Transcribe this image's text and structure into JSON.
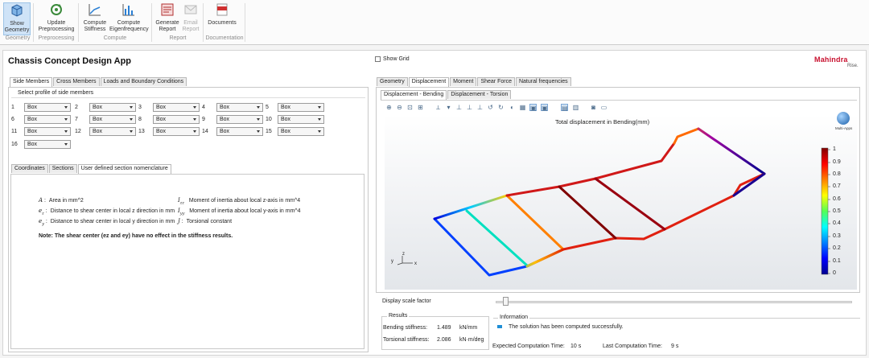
{
  "ribbon": {
    "buttons": [
      {
        "id": "show-geometry",
        "line1": "Show",
        "line2": "Geometry",
        "active": true
      },
      {
        "id": "update-preprocessing",
        "line1": "Update",
        "line2": "Preprocessing"
      },
      {
        "id": "compute-stiffness",
        "line1": "Compute",
        "line2": "Stiffness"
      },
      {
        "id": "compute-eigenfrequency",
        "line1": "Compute",
        "line2": "Eigenfrequency"
      },
      {
        "id": "generate-report",
        "line1": "Generate",
        "line2": "Report"
      },
      {
        "id": "email-report",
        "line1": "Email",
        "line2": "Report",
        "disabled": true
      },
      {
        "id": "documents",
        "line1": "Documents",
        "line2": ""
      }
    ],
    "groups": [
      "Geometry",
      "Preprocessing",
      "Compute",
      "Report",
      "Documentation"
    ]
  },
  "app": {
    "title": "Chassis Concept Design App",
    "show_grid": "Show Grid",
    "logo_main": "Mahindra",
    "logo_sub": "Rise."
  },
  "left": {
    "tabs": [
      "Side Members",
      "Cross Members",
      "Loads and Boundary Conditions"
    ],
    "section_title": "Select profile of side members",
    "members": [
      {
        "n": "1",
        "v": "Box"
      },
      {
        "n": "2",
        "v": "Box"
      },
      {
        "n": "3",
        "v": "Box"
      },
      {
        "n": "4",
        "v": "Box"
      },
      {
        "n": "5",
        "v": "Box"
      },
      {
        "n": "6",
        "v": "Box"
      },
      {
        "n": "7",
        "v": "Box"
      },
      {
        "n": "8",
        "v": "Box"
      },
      {
        "n": "9",
        "v": "Box"
      },
      {
        "n": "10",
        "v": "Box"
      },
      {
        "n": "11",
        "v": "Box"
      },
      {
        "n": "12",
        "v": "Box"
      },
      {
        "n": "13",
        "v": "Box"
      },
      {
        "n": "14",
        "v": "Box"
      },
      {
        "n": "15",
        "v": "Box"
      },
      {
        "n": "16",
        "v": "Box"
      }
    ],
    "subtabs": [
      "Coordinates",
      "Sections",
      "User defined section nomenclature"
    ],
    "nomenclature": [
      {
        "sym": "A",
        "sub": "",
        "desc": "Area in mm^2"
      },
      {
        "sym": "e",
        "sub": "z",
        "desc": "Distance to shear center in local z direction in mm"
      },
      {
        "sym": "e",
        "sub": "y",
        "desc": "Distance to shear center in local y direction in mm"
      },
      {
        "sym": "I",
        "sub": "zz",
        "desc": "Moment of inertia about local z-axis in mm^4"
      },
      {
        "sym": "I",
        "sub": "yy",
        "desc": "Moment of inertia about local y-axis in mm^4"
      },
      {
        "sym": "J",
        "sub": "",
        "desc": "Torsional constant"
      }
    ],
    "note": "Note: The shear center (ez and ey) have no effect in the stiffness results."
  },
  "right": {
    "tabs": [
      "Geometry",
      "Displacement",
      "Moment",
      "Shear Force",
      "Natural frequencies"
    ],
    "subtabs": [
      "Displacement - Bending",
      "Displacement - Torsion"
    ],
    "plot_title": "Total displacement in Bending(mm)",
    "legend": [
      "1",
      "0.9",
      "0.8",
      "0.7",
      "0.6",
      "0.5",
      "0.4",
      "0.3",
      "0.2",
      "0.1",
      "0"
    ],
    "axis": {
      "y": "y",
      "z": "z",
      "x": "x"
    },
    "badge": "Multi-Apps",
    "scale_label": "Display scale factor",
    "scale_fraction": 0.02,
    "results_title": "Results",
    "bending_label": "Bending stiffness:",
    "bending_value": "1.489",
    "bending_unit": "kN/mm",
    "torsional_label": "Torsional stiffness:",
    "torsional_value": "2.086",
    "torsional_unit": "kN·m/deg",
    "info_title": "Information",
    "info_msg": "The solution has been computed successfully.",
    "expected_label": "Expected Computation Time:",
    "expected_value": "10 s",
    "last_label": "Last Computation Time:",
    "last_value": "9 s"
  },
  "colors": {
    "accent": "#0072c6",
    "brand_red": "#c8102e"
  }
}
